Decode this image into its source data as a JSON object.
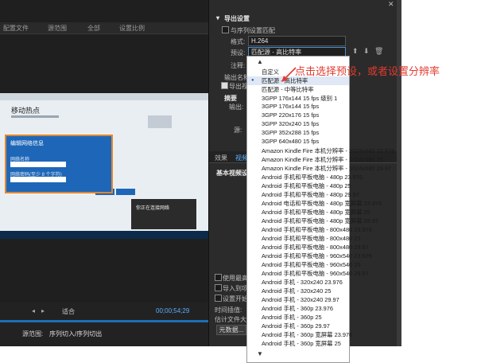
{
  "left": {
    "toolbar": [
      "配置文件",
      "源范围",
      "全部",
      "设置比例"
    ],
    "preview_title": "移动热点",
    "dialog_title": "编辑网络信息",
    "dialog_field1": "网络名称",
    "dialog_field2": "网络密码(至少 8 个字符)",
    "dialog_save": "保存",
    "dialog_cancel": "取消",
    "notif_title": "你正在连接网络",
    "fit_label": "适合",
    "timecode": "00;00;54;29",
    "source_range_label": "源范围:",
    "source_range_value": "序列切入/序列切出"
  },
  "right": {
    "export_settings": "导出设置",
    "match_sequence": "与序列设置匹配",
    "format_label": "格式:",
    "format_value": "H.264",
    "preset_label": "预设:",
    "preset_value": "匹配源 - 高比特率",
    "comments_label": "注释:",
    "output_label": "输出名称:",
    "export_video": "导出视频",
    "summary": "摘要",
    "output_short": "输出:",
    "source_short": "源:",
    "tabs": [
      "效果",
      "视频"
    ],
    "basic_video": "基本视频设",
    "bottom_checks": [
      "使用最高渲染",
      "导入到项目中",
      "设置开始时间"
    ],
    "time_interp": "时间插值:",
    "file_size": "估计文件大小:",
    "metadata_btn": "元数据..."
  },
  "dropdown": {
    "items": [
      "自定义",
      "匹配源 - 高比特率",
      "匹配源 - 中等比特率",
      "3GPP 176x144 15 fps 级别 1",
      "3GPP 176x144 15 fps",
      "3GPP 220x176 15 fps",
      "3GPP 320x240 15 fps",
      "3GPP 352x288 15 fps",
      "3GPP 640x480 15 fps",
      "Amazon Kindle Fire 本机分辨率 - 1024x580 23.976",
      "Amazon Kindle Fire 本机分辨率 - 1024x580 25",
      "Amazon Kindle Fire 本机分辨率 - 1024x580 29.97",
      "Android 手机和平板电脑 - 480p 23.976",
      "Android 手机和平板电脑 - 480p 25",
      "Android 手机和平板电脑 - 480p 29.97",
      "Android 电话和平板电脑 - 480p 宽屏幕 23.976",
      "Android 手机和平板电脑 - 480p 宽屏幕 25",
      "Android 手机和平板电脑 - 480p 宽屏幕 29.97",
      "Android 手机和平板电脑 - 800x480 23.976",
      "Android 手机和平板电脑 - 800x480 25",
      "Android 手机和平板电脑 - 800x480 29.97",
      "Android 手机和平板电脑 - 960x540 23.976",
      "Android 手机和平板电脑 - 960x540 25",
      "Android 手机和平板电脑 - 960x540 29.97",
      "Android 手机 - 320x240 23.976",
      "Android 手机 - 320x240 25",
      "Android 手机 - 320x240 29.97",
      "Android 手机 - 360p 23.976",
      "Android 手机 - 360p 25",
      "Android 手机 - 360p 29.97",
      "Android 手机 - 360p 宽屏幕 23.976",
      "Android 手机 - 360p 宽屏幕 25"
    ]
  },
  "annotation": "点击选择预设，或者设置分辨率",
  "colors": {
    "annotation": "#e23b2e",
    "dialog_blue": "#1e67b8",
    "dialog_border": "#e3862c",
    "panel_bg": "#2b2b2b"
  }
}
